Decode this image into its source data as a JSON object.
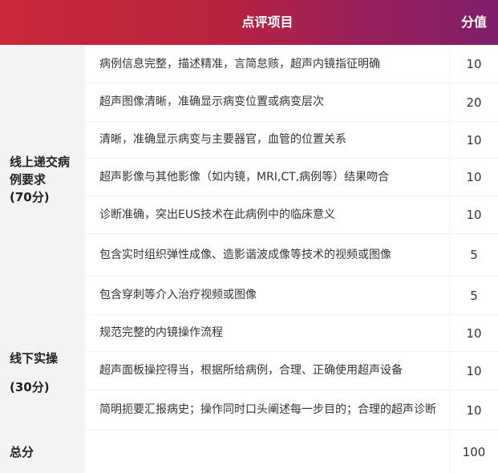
{
  "header": {
    "item_label": "点评项目",
    "score_label": "分值"
  },
  "sections": [
    {
      "category_line1": "线上递交病",
      "category_line2": "例要求",
      "category_line3": "(70分)",
      "rows": [
        {
          "text": "病例信息完整，描述精准，言简怠赅，超声内镜指征明确",
          "score": "10"
        },
        {
          "text": "超声图像清晰，准确显示病变位置或病变层次",
          "score": "20"
        },
        {
          "text": "清晰，准确显示病变与主要器官，血管的位置关系",
          "score": "10"
        },
        {
          "text": "超声影像与其他影像（如内镜，MRI,CT,病例等）结果吻合",
          "score": "10"
        },
        {
          "text": "诊断准确，突出EUS技术在此病例中的临床意义",
          "score": "10"
        },
        {
          "text": "包含实时组织弹性成像、造影谐波成像等技术的视频或图像",
          "score": "5"
        },
        {
          "text": "包含穿刺等介入治疗视频或图像",
          "score": "5"
        }
      ]
    },
    {
      "category_line1": "线下实操",
      "category_line2": "(30分)",
      "rows": [
        {
          "text": "规范完整的内镜操作流程",
          "score": "10"
        },
        {
          "text": "超声面板操控得当，根据所给病例，合理、正确使用超声设备",
          "score": "10"
        },
        {
          "text": "简明扼要汇报病史；操作同时口头阐述每一步目的；合理的超声诊断",
          "score": "10"
        }
      ]
    }
  ],
  "total": {
    "label": "总分",
    "score": "100"
  }
}
